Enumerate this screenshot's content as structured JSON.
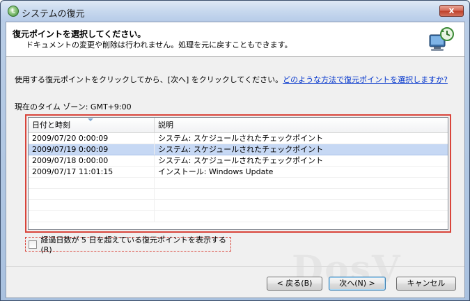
{
  "window": {
    "title": "システムの復元",
    "close_glyph": "x"
  },
  "header": {
    "title": "復元ポイントを選択してください。",
    "subtitle": "ドキュメントの変更や削除は行われません。処理を元に戻すこともできます。",
    "art_icon": "system-restore-computer-icon"
  },
  "instruction": {
    "text": "使用する復元ポイントをクリックしてから、[次へ] をクリックしてください。",
    "link": "どのような方法で復元ポイントを選択しますか?"
  },
  "timezone_label": "現在のタイム ゾーン: GMT+9:00",
  "list": {
    "columns": [
      "日付と時刻",
      "説明"
    ],
    "rows": [
      {
        "date": "2009/07/20 0:00:09",
        "desc": "システム: スケジュールされたチェックポイント"
      },
      {
        "date": "2009/07/19 0:00:09",
        "desc": "システム: スケジュールされたチェックポイント"
      },
      {
        "date": "2009/07/18 0:00:00",
        "desc": "システム: スケジュールされたチェックポイント"
      },
      {
        "date": "2009/07/17 11:01:15",
        "desc": "インストール: Windows Update"
      }
    ],
    "selected_index": 1
  },
  "checkbox": {
    "label": "経過日数が 5 日を超えている復元ポイントを表示する(R)",
    "checked": false
  },
  "buttons": {
    "back": "< 戻る(B)",
    "next": "次へ(N) >",
    "cancel": "キャンセル"
  },
  "colors": {
    "highlight_border": "#d9443a",
    "selected_row": "#c6d8f4",
    "link": "#0033cc"
  }
}
